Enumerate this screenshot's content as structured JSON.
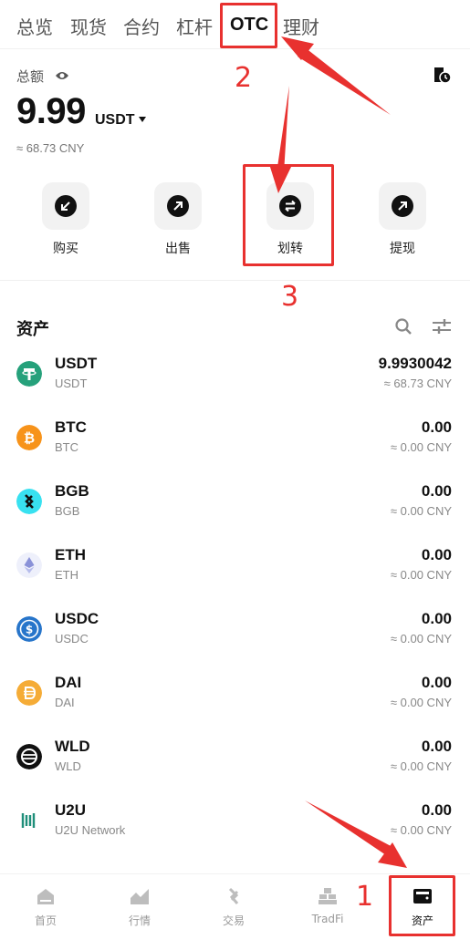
{
  "tabs": [
    {
      "label": "总览",
      "active": false
    },
    {
      "label": "现货",
      "active": false
    },
    {
      "label": "合约",
      "active": false
    },
    {
      "label": "杠杆",
      "active": false
    },
    {
      "label": "OTC",
      "active": true
    },
    {
      "label": "理财",
      "active": false
    }
  ],
  "balance": {
    "label": "总额",
    "amount": "9.99",
    "unit": "USDT",
    "fiat": "≈ 68.73 CNY",
    "icons": [
      "eye-icon",
      "history-icon"
    ]
  },
  "actions": [
    {
      "label": "购买",
      "icon": "arrow-down-left-icon"
    },
    {
      "label": "出售",
      "icon": "arrow-up-right-icon"
    },
    {
      "label": "划转",
      "icon": "transfer-icon"
    },
    {
      "label": "提现",
      "icon": "arrow-up-right-icon"
    }
  ],
  "assets": {
    "title": "资产",
    "items": [
      {
        "symbol": "USDT",
        "name": "USDT",
        "amount": "9.9930042",
        "fiat": "≈ 68.73 CNY",
        "color": "#26a17b"
      },
      {
        "symbol": "BTC",
        "name": "BTC",
        "amount": "0.00",
        "fiat": "≈ 0.00 CNY",
        "color": "#f7931a"
      },
      {
        "symbol": "BGB",
        "name": "BGB",
        "amount": "0.00",
        "fiat": "≈ 0.00 CNY",
        "color": "#38e1f0"
      },
      {
        "symbol": "ETH",
        "name": "ETH",
        "amount": "0.00",
        "fiat": "≈ 0.00 CNY",
        "color": "#eef0fb"
      },
      {
        "symbol": "USDC",
        "name": "USDC",
        "amount": "0.00",
        "fiat": "≈ 0.00 CNY",
        "color": "#2775ca"
      },
      {
        "symbol": "DAI",
        "name": "DAI",
        "amount": "0.00",
        "fiat": "≈ 0.00 CNY",
        "color": "#f5ac37"
      },
      {
        "symbol": "WLD",
        "name": "WLD",
        "amount": "0.00",
        "fiat": "≈ 0.00 CNY",
        "color": "#111111"
      },
      {
        "symbol": "U2U",
        "name": "U2U Network",
        "amount": "0.00",
        "fiat": "≈ 0.00 CNY",
        "color": "#1f8f7a"
      }
    ]
  },
  "bottom_nav": [
    {
      "label": "首页",
      "icon": "home-icon",
      "active": false
    },
    {
      "label": "行情",
      "icon": "market-chart-icon",
      "active": false
    },
    {
      "label": "交易",
      "icon": "trade-icon",
      "active": false
    },
    {
      "label": "TradFi",
      "icon": "tradfi-icon",
      "active": false
    },
    {
      "label": "资产",
      "icon": "wallet-icon",
      "active": true
    }
  ],
  "annotations": {
    "step1": "1",
    "step2": "2",
    "step3": "3",
    "color": "#e8312f"
  }
}
